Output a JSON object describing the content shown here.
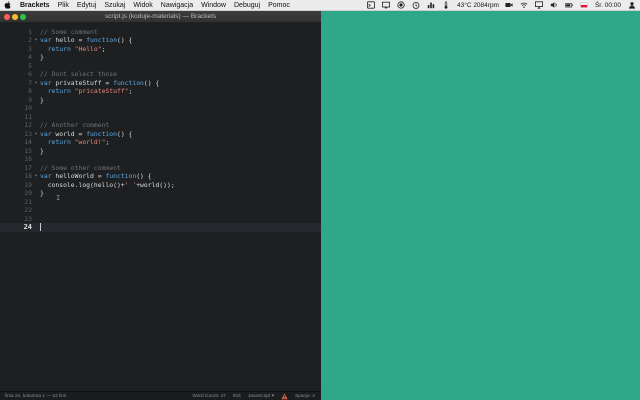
{
  "menubar": {
    "app_name": "Brackets",
    "items": [
      "Plik",
      "Edytuj",
      "Szukaj",
      "Widok",
      "Nawigacja",
      "Window",
      "Debuguj",
      "Pomoc"
    ],
    "status_text": "43°C 2084rpm",
    "clock": "Śr. 00:00"
  },
  "window": {
    "title": "script.js (koduje-materials) — Brackets"
  },
  "editor": {
    "lines": [
      {
        "num": "1",
        "fold": "",
        "tokens": [
          {
            "c": "c-comment",
            "t": "// Some comment"
          }
        ]
      },
      {
        "num": "2",
        "fold": "▾",
        "tokens": [
          {
            "c": "c-keyword",
            "t": "var"
          },
          {
            "c": "c-plain",
            "t": " hello = "
          },
          {
            "c": "c-keyword",
            "t": "function"
          },
          {
            "c": "c-plain",
            "t": "() {"
          }
        ]
      },
      {
        "num": "3",
        "fold": "",
        "tokens": [
          {
            "c": "c-plain",
            "t": "  "
          },
          {
            "c": "c-keyword",
            "t": "return"
          },
          {
            "c": "c-plain",
            "t": " "
          },
          {
            "c": "c-string",
            "t": "\"Hello\""
          },
          {
            "c": "c-plain",
            "t": ";"
          }
        ]
      },
      {
        "num": "4",
        "fold": "",
        "tokens": [
          {
            "c": "c-plain",
            "t": "}"
          }
        ]
      },
      {
        "num": "5",
        "fold": "",
        "tokens": []
      },
      {
        "num": "6",
        "fold": "",
        "tokens": [
          {
            "c": "c-comment",
            "t": "// Dont select those"
          }
        ]
      },
      {
        "num": "7",
        "fold": "▾",
        "tokens": [
          {
            "c": "c-keyword",
            "t": "var"
          },
          {
            "c": "c-plain",
            "t": " privateStuff = "
          },
          {
            "c": "c-keyword",
            "t": "function"
          },
          {
            "c": "c-plain",
            "t": "() {"
          }
        ]
      },
      {
        "num": "8",
        "fold": "",
        "tokens": [
          {
            "c": "c-plain",
            "t": "  "
          },
          {
            "c": "c-keyword",
            "t": "return"
          },
          {
            "c": "c-plain",
            "t": " "
          },
          {
            "c": "c-string",
            "t": "\"pricateStuff\""
          },
          {
            "c": "c-plain",
            "t": ";"
          }
        ]
      },
      {
        "num": "9",
        "fold": "",
        "tokens": [
          {
            "c": "c-plain",
            "t": "}"
          }
        ]
      },
      {
        "num": "10",
        "fold": "",
        "tokens": []
      },
      {
        "num": "11",
        "fold": "",
        "tokens": []
      },
      {
        "num": "12",
        "fold": "",
        "tokens": [
          {
            "c": "c-comment",
            "t": "// Another comment"
          }
        ]
      },
      {
        "num": "13",
        "fold": "▾",
        "tokens": [
          {
            "c": "c-keyword",
            "t": "var"
          },
          {
            "c": "c-plain",
            "t": " world = "
          },
          {
            "c": "c-keyword",
            "t": "function"
          },
          {
            "c": "c-plain",
            "t": "() {"
          }
        ]
      },
      {
        "num": "14",
        "fold": "",
        "tokens": [
          {
            "c": "c-plain",
            "t": "  "
          },
          {
            "c": "c-keyword",
            "t": "return"
          },
          {
            "c": "c-plain",
            "t": " "
          },
          {
            "c": "c-string",
            "t": "\"world!\""
          },
          {
            "c": "c-plain",
            "t": ";"
          }
        ]
      },
      {
        "num": "15",
        "fold": "",
        "tokens": [
          {
            "c": "c-plain",
            "t": "}"
          }
        ]
      },
      {
        "num": "16",
        "fold": "",
        "tokens": []
      },
      {
        "num": "17",
        "fold": "",
        "tokens": [
          {
            "c": "c-comment",
            "t": "// Some other comment"
          }
        ]
      },
      {
        "num": "18",
        "fold": "▾",
        "tokens": [
          {
            "c": "c-keyword",
            "t": "var"
          },
          {
            "c": "c-plain",
            "t": " helloWorld = "
          },
          {
            "c": "c-keyword",
            "t": "function"
          },
          {
            "c": "c-plain",
            "t": "() {"
          }
        ]
      },
      {
        "num": "19",
        "fold": "",
        "tokens": [
          {
            "c": "c-plain",
            "t": "  console.log(hello()+"
          },
          {
            "c": "c-string",
            "t": "' '"
          },
          {
            "c": "c-plain",
            "t": "+world());"
          }
        ]
      },
      {
        "num": "20",
        "fold": "",
        "tokens": [
          {
            "c": "c-plain",
            "t": "}"
          }
        ]
      },
      {
        "num": "21",
        "fold": "",
        "tokens": []
      },
      {
        "num": "22",
        "fold": "",
        "tokens": []
      },
      {
        "num": "23",
        "fold": "",
        "tokens": []
      },
      {
        "num": "24",
        "fold": "",
        "tokens": [],
        "active": true
      }
    ]
  },
  "statusbar": {
    "position": "linia 24, kolumna 1 — 24 linii",
    "word_count": "Word Count: 47",
    "ins": "INS",
    "language": "JavaScript ▾",
    "spaces": "Spacje:  2"
  },
  "colors": {
    "desktop": "#2fa88a",
    "editor_bg": "#1d1f21",
    "keyword": "#5aa9e6",
    "string": "#e9887a",
    "comment": "#6c7176",
    "warning": "#e8583a"
  },
  "icons": {
    "menubar": [
      "apple-icon",
      "terminal-icon",
      "screen-icon",
      "record-icon",
      "timer-icon",
      "stats-icon",
      "thermometer-icon",
      "camera-icon",
      "wifi-icon",
      "airplay-icon",
      "volume-icon",
      "battery-icon",
      "flag-icon",
      "user-icon"
    ],
    "status": [
      "warning-icon"
    ]
  }
}
